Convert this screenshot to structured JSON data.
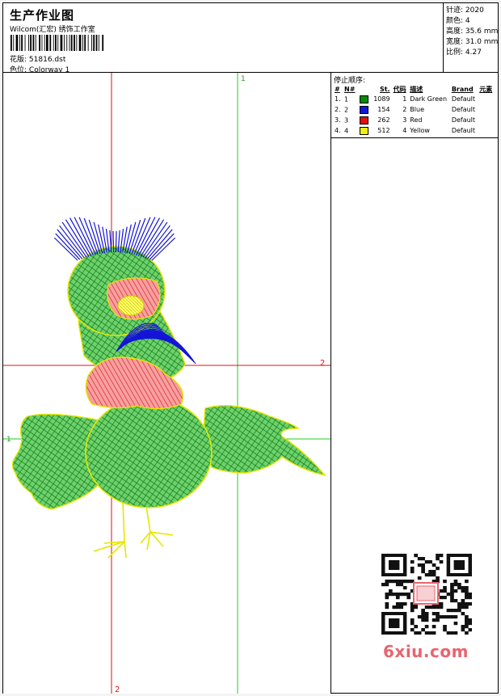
{
  "header": {
    "title": "生产作业图",
    "company": "Wilcom(汇宏) 绣饰工作室",
    "design_file_label": "花版:",
    "design_file": "51816.dst",
    "colorway_label": "色位:",
    "colorway": "Colorway 1"
  },
  "stats": [
    {
      "label": "针迹:",
      "value": "2020"
    },
    {
      "label": "颜色:",
      "value": "4"
    },
    {
      "label": "高度:",
      "value": "35.6 mm"
    },
    {
      "label": "宽度:",
      "value": "31.0 mm"
    },
    {
      "label": "比例:",
      "value": "4.27"
    }
  ],
  "stop_sequence": {
    "title": "停止顺序:",
    "columns": [
      "#",
      "N#",
      "St.",
      "代码",
      "描述",
      "Brand",
      "元素"
    ],
    "rows": [
      {
        "idx": "1.",
        "n": "1",
        "stitches": "1089",
        "code": "1",
        "desc": "Dark Green",
        "brand": "Default",
        "color": "#0a8a0a"
      },
      {
        "idx": "2.",
        "n": "2",
        "stitches": "154",
        "code": "2",
        "desc": "Blue",
        "brand": "Default",
        "color": "#1414d8"
      },
      {
        "idx": "3.",
        "n": "3",
        "stitches": "262",
        "code": "3",
        "desc": "Red",
        "brand": "Default",
        "color": "#e01010"
      },
      {
        "idx": "4.",
        "n": "4",
        "stitches": "512",
        "code": "4",
        "desc": "Yellow",
        "brand": "Default",
        "color": "#f0f010"
      }
    ]
  },
  "axes": {
    "top_label": "1",
    "right_label": "2",
    "left_label": "1",
    "bottom_label": "2"
  },
  "watermark": "6xiu.com",
  "colors": {
    "green_line": "#22cc22",
    "red_line": "#e01010",
    "thread_green": "#0a8a0a",
    "thread_blue": "#1414d8",
    "thread_red": "#e01010",
    "thread_yellow": "#f0f010"
  }
}
